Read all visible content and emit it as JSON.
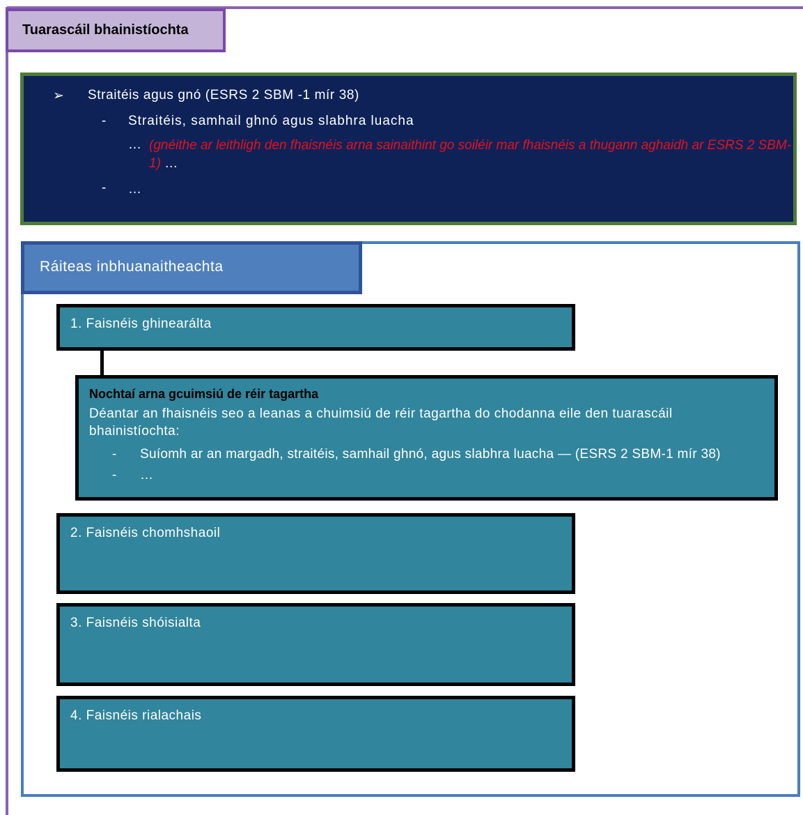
{
  "management_report": {
    "title": "Tuarascáil bhainistíochta"
  },
  "strategy_box": {
    "bullet_symbol": "➢",
    "heading": "Straitéis agus gnó (ESRS 2 SBM -1 mír 38)",
    "sub_items": [
      {
        "dash": "-",
        "text": "Straitéis, samhail ghnó agus slabhra luacha"
      },
      {
        "dash": "-",
        "text": "…"
      }
    ],
    "ellipsis_prefix": "…",
    "note_red": "(gnéithe ar leithligh den fhaisnéis arna sainaithint go soiléir mar fhaisnéis a thugann aghaidh ar ESRS 2 SBM-1)",
    "note_suffix": "…",
    "colors": {
      "background": "#0e2258",
      "border": "#4e7b39",
      "note": "#e8101c"
    }
  },
  "sustainability_statement": {
    "title": "Ráiteas inbhuanaitheachta",
    "sections": [
      {
        "label": "1. Faisnéis ghinearálta"
      },
      {
        "label": "2. Faisnéis chomhshaoil"
      },
      {
        "label": "3. Faisnéis shóisialta"
      },
      {
        "label": "4. Faisnéis rialachais"
      }
    ],
    "incorporated": {
      "title": "Nochtaí arna gcuimsiú de réir tagartha",
      "description": "Déantar an fhaisnéis seo a leanas a chuimsiú de réir tagartha do chodanna eile den tuarascáil bhainistíochta:",
      "items": [
        {
          "dash": "-",
          "text": "Suíomh ar an margadh, straitéis, samhail ghnó, agus slabhra luacha — (ESRS 2 SBM-1 mír 38)"
        },
        {
          "dash": "-",
          "text": "…"
        }
      ]
    },
    "colors": {
      "tab": "#4f80bd",
      "section_fill": "#31859c",
      "frame": "#4a7ebf"
    }
  }
}
